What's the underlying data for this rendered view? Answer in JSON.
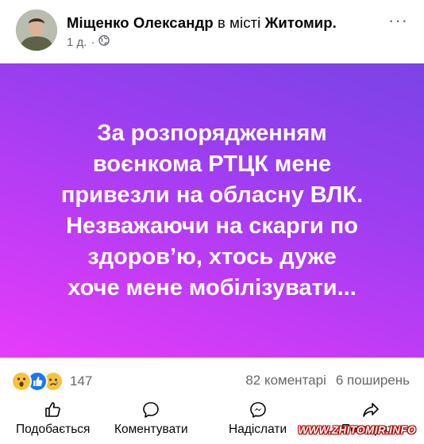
{
  "post": {
    "author": "Міщенко Олександр",
    "in_city": "в місті",
    "city": "Житомир",
    "city_suffix": ".",
    "time": "1 д.",
    "privacy_separator": "·",
    "privacy_icon": "globe-icon",
    "more_icon": "more-icon",
    "more_label": "···"
  },
  "banner": {
    "text": "За розпорядженням\nвоєнкома РТЦК  мене\nпривезли на обласну ВЛК.\nНезважаючи на скарги по\nздоров’ю,  хтось дуже\nхоче мене мобілізувати...",
    "gradient_start": "#7a44e6",
    "gradient_end": "#e63cfb",
    "text_color": "#ffffff"
  },
  "stats": {
    "reaction_icons": [
      "wow-reaction-icon",
      "like-reaction-icon",
      "sad-reaction-icon"
    ],
    "reaction_count": "147",
    "comments": "82 коментарі",
    "shares": "6 поширень"
  },
  "actions": {
    "like": {
      "label": "Подобається",
      "icon": "thumbs-up-icon"
    },
    "comment": {
      "label": "Коментувати",
      "icon": "comment-bubble-icon"
    },
    "send": {
      "label": "Надіслати",
      "icon": "messenger-icon"
    },
    "share": {
      "label": "Поширити",
      "icon": "share-arrow-icon"
    }
  },
  "watermark": "WWW.ZHITOMIR.INFO",
  "colors": {
    "secondary_text": "#65676b",
    "like_blue": "#1877f2",
    "reaction_yellow": "#f7c33d"
  }
}
